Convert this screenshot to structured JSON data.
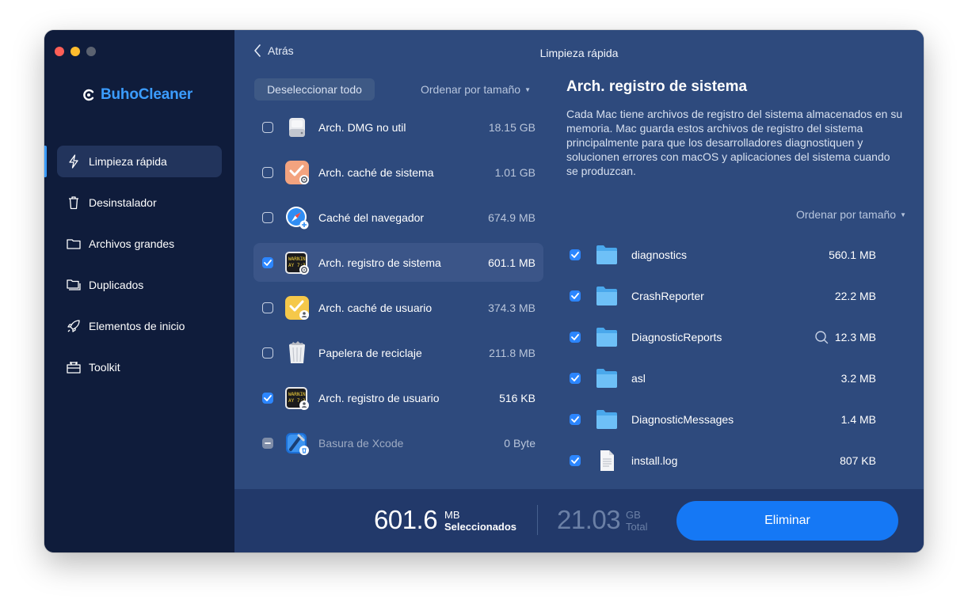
{
  "app": {
    "name": "BuhoCleaner"
  },
  "sidebar": {
    "items": [
      {
        "label": "Limpieza rápida",
        "icon": "lightning-icon",
        "active": true
      },
      {
        "label": "Desinstalador",
        "icon": "trash-icon"
      },
      {
        "label": "Archivos grandes",
        "icon": "folder-icon"
      },
      {
        "label": "Duplicados",
        "icon": "folders-icon"
      },
      {
        "label": "Elementos de inicio",
        "icon": "rocket-icon"
      },
      {
        "label": "Toolkit",
        "icon": "toolbox-icon"
      }
    ]
  },
  "header": {
    "back_label": "Atrás",
    "title": "Limpieza rápida"
  },
  "left_panel": {
    "deselect_label": "Deseleccionar todo",
    "sort_label": "Ordenar por tamaño",
    "categories": [
      {
        "name": "Arch. DMG no util",
        "size": "18.15 GB",
        "checked": false,
        "icon": "disk-icon"
      },
      {
        "name": "Arch. caché de sistema",
        "size": "1.01 GB",
        "checked": false,
        "icon": "system-cache-icon"
      },
      {
        "name": "Caché del navegador",
        "size": "674.9 MB",
        "checked": false,
        "icon": "safari-icon"
      },
      {
        "name": "Arch. registro de sistema",
        "size": "601.1 MB",
        "checked": true,
        "selected": true,
        "icon": "console-log-icon"
      },
      {
        "name": "Arch. caché de usuario",
        "size": "374.3 MB",
        "checked": false,
        "icon": "user-cache-icon"
      },
      {
        "name": "Papelera de reciclaje",
        "size": "211.8 MB",
        "checked": false,
        "icon": "trash-bin-icon"
      },
      {
        "name": "Arch. registro de usuario",
        "size": "516 KB",
        "checked": true,
        "icon": "user-log-icon"
      },
      {
        "name": "Basura de Xcode",
        "size": "0 Byte",
        "checked": "partial",
        "icon": "xcode-icon"
      }
    ]
  },
  "detail": {
    "title": "Arch. registro de sistema",
    "description": "Cada Mac tiene archivos de registro del sistema almacenados en su memoria. Mac guarda estos archivos de registro del sistema principalmente para que los desarrolladores diagnostiquen y solucionen errores con macOS y aplicaciones del sistema cuando se produzcan.",
    "sort_label": "Ordenar por tamaño",
    "files": [
      {
        "name": "diagnostics",
        "size": "560.1 MB",
        "checked": true,
        "type": "folder"
      },
      {
        "name": "CrashReporter",
        "size": "22.2 MB",
        "checked": true,
        "type": "folder"
      },
      {
        "name": "DiagnosticReports",
        "size": "12.3 MB",
        "checked": true,
        "type": "folder",
        "search": true
      },
      {
        "name": "asl",
        "size": "3.2 MB",
        "checked": true,
        "type": "folder"
      },
      {
        "name": "DiagnosticMessages",
        "size": "1.4 MB",
        "checked": true,
        "type": "folder"
      },
      {
        "name": "install.log",
        "size": "807 KB",
        "checked": true,
        "type": "file"
      }
    ]
  },
  "footer": {
    "selected_value": "601.6",
    "selected_unit": "MB",
    "selected_label": "Seleccionados",
    "total_value": "21.03",
    "total_unit": "GB",
    "total_label": "Total",
    "delete_label": "Eliminar"
  },
  "colors": {
    "accent": "#1578f5",
    "sidebar_bg": "#0f1c3b",
    "main_bg": "#2e4a7d",
    "brand": "#3b9cff"
  }
}
